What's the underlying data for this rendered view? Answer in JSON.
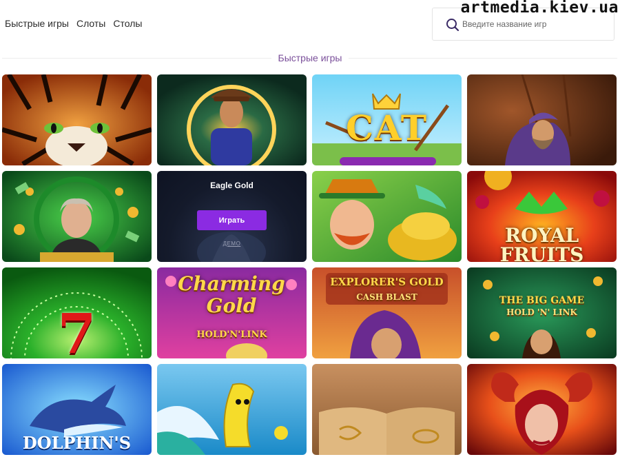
{
  "watermark": "artmedia.kiev.ua",
  "nav": {
    "items": [
      {
        "label": "Быстрые игры"
      },
      {
        "label": "Слоты"
      },
      {
        "label": "Столы"
      }
    ]
  },
  "search": {
    "placeholder": "Введите название игр",
    "value": ""
  },
  "section": {
    "title": "Быстрые игры"
  },
  "games": [
    {
      "icon": "tiger-art"
    },
    {
      "icon": "adventurer-art"
    },
    {
      "icon": "cat-clans-art",
      "logo": "CAT"
    },
    {
      "icon": "bearded-man-art"
    },
    {
      "icon": "franklin-money-art"
    },
    {
      "icon": "eagle-gold-art",
      "title": "Eagle Gold",
      "play_label": "Играть",
      "demo_label": "ДЕМО"
    },
    {
      "icon": "leprechaun-art"
    },
    {
      "icon": "royal-fruits-art",
      "logo": "ROYAL FRUITS"
    },
    {
      "icon": "sevens-art",
      "logo": "7"
    },
    {
      "icon": "charming-gold-art",
      "logo": "Charming Gold",
      "sub": "HOLD'N'LINK"
    },
    {
      "icon": "explorers-gold-art",
      "logo": "EXPLORER'S GOLD",
      "sub": "CASH BLAST"
    },
    {
      "icon": "big-game-art",
      "logo": "THE BIG GAME",
      "sub": "HOLD 'N' LINK"
    },
    {
      "icon": "dolphin-art",
      "logo": "DOLPHIN'S"
    },
    {
      "icon": "banana-art"
    },
    {
      "icon": "book-art"
    },
    {
      "icon": "demon-lady-art"
    }
  ],
  "colors": {
    "accent": "#8b2be2",
    "section_title": "#7a4f9a"
  }
}
